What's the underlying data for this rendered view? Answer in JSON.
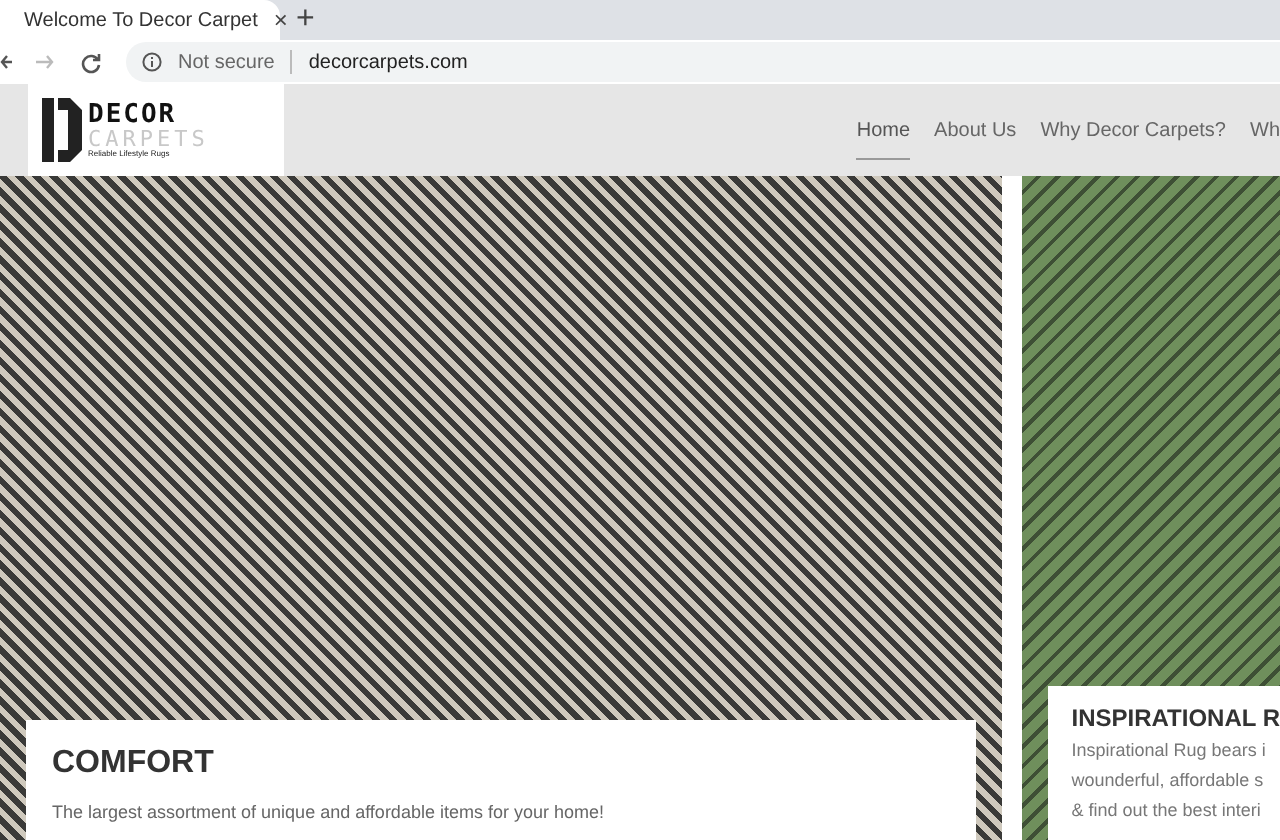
{
  "browser": {
    "tab_title": "Welcome To Decor Carpet",
    "tab_close": "×",
    "new_tab": "+",
    "security": "Not secure",
    "url": "decorcarpets.com"
  },
  "logo": {
    "name": "DECOR",
    "sub": "CARPETS",
    "tagline": "Reliable Lifestyle Rugs"
  },
  "nav": [
    {
      "label": "Home",
      "selected": true
    },
    {
      "label": "About Us",
      "selected": false
    },
    {
      "label": "Why Decor Carpets?",
      "selected": false
    },
    {
      "label": "Wh",
      "selected": false
    }
  ],
  "slides": [
    {
      "title": "COMFORT",
      "lines": [
        "The largest assortment of unique and affordable items for your home!"
      ]
    },
    {
      "title": "INSPIRATIONAL R",
      "lines": [
        "Inspirational Rug bears i",
        "wounderful, affordable s",
        "& find out the best interi"
      ]
    }
  ]
}
